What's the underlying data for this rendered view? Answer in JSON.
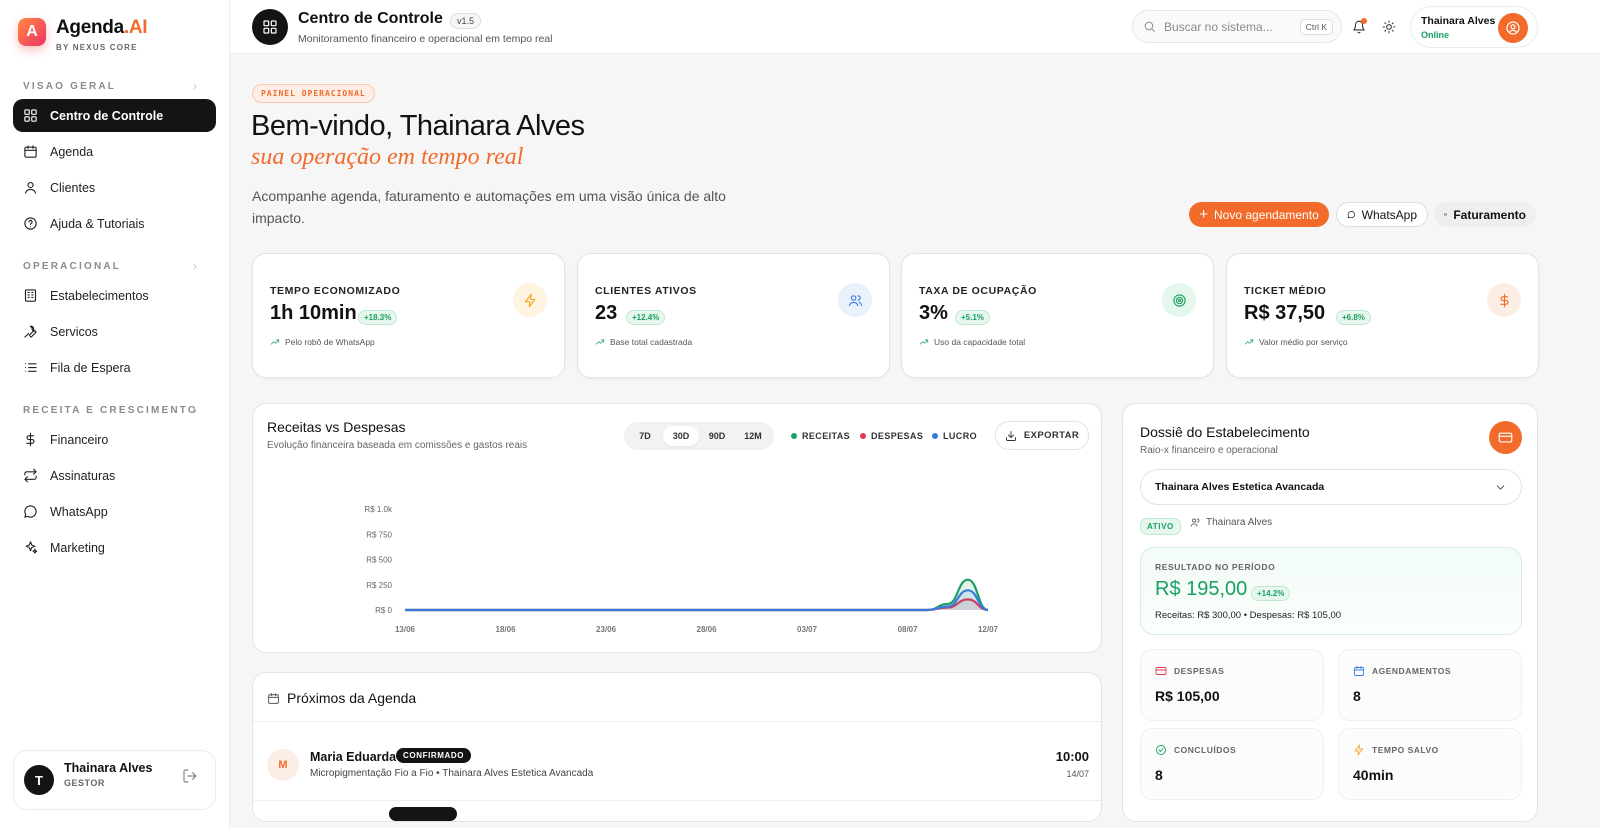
{
  "brand": {
    "logo_letter": "A",
    "name_main": "Agenda",
    "name_accent": ".AI",
    "subtitle": "BY NEXUS CORE"
  },
  "sidebar": {
    "sections": [
      {
        "title": "VISAO GERAL",
        "items": [
          {
            "label": "Centro de Controle",
            "icon": "grid-icon",
            "active": true
          },
          {
            "label": "Agenda",
            "icon": "calendar-icon"
          },
          {
            "label": "Clientes",
            "icon": "user-icon"
          },
          {
            "label": "Ajuda & Tutoriais",
            "icon": "help-icon"
          }
        ]
      },
      {
        "title": "OPERACIONAL",
        "items": [
          {
            "label": "Estabelecimentos",
            "icon": "building-icon"
          },
          {
            "label": "Servicos",
            "icon": "wrench-icon"
          },
          {
            "label": "Fila de Espera",
            "icon": "list-icon"
          }
        ]
      },
      {
        "title": "RECEITA E CRESCIMENTO",
        "items": [
          {
            "label": "Financeiro",
            "icon": "dollar-icon"
          },
          {
            "label": "Assinaturas",
            "icon": "repeat-icon"
          },
          {
            "label": "WhatsApp",
            "icon": "chat-icon"
          },
          {
            "label": "Marketing",
            "icon": "sparkle-icon"
          }
        ]
      }
    ],
    "user": {
      "initial": "T",
      "name": "Thainara Alves",
      "role": "GESTOR"
    }
  },
  "header": {
    "title": "Centro de Controle",
    "version": "v1.5",
    "subtitle": "Monitoramento financeiro e operacional em tempo real",
    "search_placeholder": "Buscar no sistema...",
    "shortcut": "Ctrl K",
    "user_name": "Thainara Alves",
    "user_status": "Online"
  },
  "hero": {
    "badge": "PAINEL OPERACIONAL",
    "welcome": "Bem-vindo, Thainara Alves",
    "tagline": "sua operação em tempo real",
    "description": "Acompanhe agenda, faturamento e automações em uma visão única de alto impacto.",
    "buttons": {
      "new": "Novo agendamento",
      "whatsapp": "WhatsApp",
      "billing": "Faturamento"
    }
  },
  "kpis": [
    {
      "label": "TEMPO ECONOMIZADO",
      "value": "1h 10min",
      "delta": "+18.3%",
      "note": "Pelo robô de WhatsApp",
      "icon": "bolt-icon",
      "color": "#f5a623",
      "bg": "#fff4e0"
    },
    {
      "label": "CLIENTES ATIVOS",
      "value": "23",
      "delta": "+12.4%",
      "note": "Base total cadastrada",
      "icon": "users-icon",
      "color": "#3b7be0",
      "bg": "#e9f1fd"
    },
    {
      "label": "TAXA DE OCUPAÇÃO",
      "value": "3%",
      "delta": "+5.1%",
      "note": "Uso da capacidade total",
      "icon": "target-icon",
      "color": "#1aa061",
      "bg": "#e4f7ec"
    },
    {
      "label": "TICKET MÉDIO",
      "value": "R$ 37,50",
      "delta": "+6.8%",
      "note": "Valor médio por serviço",
      "icon": "dollar-icon",
      "color": "#f26b2a",
      "bg": "#fdeee5"
    }
  ],
  "chart_card": {
    "title": "Receitas vs Despesas",
    "subtitle": "Evolução financeira baseada em comissões e gastos reais",
    "periods": [
      "7D",
      "30D",
      "90D",
      "12M"
    ],
    "active_period": "30D",
    "export": "EXPORTAR"
  },
  "chart_data": {
    "type": "area",
    "title": "Receitas vs Despesas",
    "x": [
      "13/06",
      "14/06",
      "15/06",
      "16/06",
      "17/06",
      "18/06",
      "19/06",
      "20/06",
      "21/06",
      "22/06",
      "23/06",
      "24/06",
      "25/06",
      "26/06",
      "27/06",
      "28/06",
      "29/06",
      "30/06",
      "01/07",
      "02/07",
      "03/07",
      "04/07",
      "05/07",
      "06/07",
      "07/07",
      "08/07",
      "09/07",
      "10/07",
      "11/07",
      "12/07"
    ],
    "xticks": [
      "13/06",
      "18/06",
      "23/06",
      "28/06",
      "03/07",
      "08/07",
      "12/07"
    ],
    "yticks": [
      "R$ 0",
      "R$ 250",
      "R$ 500",
      "R$ 750",
      "R$ 1.0k"
    ],
    "ylim": [
      0,
      1000
    ],
    "series": [
      {
        "name": "RECEITAS",
        "color": "#1aa061",
        "values": [
          0,
          0,
          0,
          0,
          0,
          0,
          0,
          0,
          0,
          0,
          0,
          0,
          0,
          0,
          0,
          0,
          0,
          0,
          0,
          0,
          0,
          0,
          0,
          0,
          0,
          0,
          0,
          60,
          300,
          0
        ]
      },
      {
        "name": "DESPESAS",
        "color": "#e0384e",
        "values": [
          0,
          0,
          0,
          0,
          0,
          0,
          0,
          0,
          0,
          0,
          0,
          0,
          0,
          0,
          0,
          0,
          0,
          0,
          0,
          0,
          0,
          0,
          0,
          0,
          0,
          0,
          0,
          25,
          105,
          0
        ]
      },
      {
        "name": "LUCRO",
        "color": "#3b7be0",
        "values": [
          0,
          0,
          0,
          0,
          0,
          0,
          0,
          0,
          0,
          0,
          0,
          0,
          0,
          0,
          0,
          0,
          0,
          0,
          0,
          0,
          0,
          0,
          0,
          0,
          0,
          0,
          0,
          35,
          195,
          0
        ]
      }
    ]
  },
  "agenda": {
    "title": "Próximos da Agenda",
    "items": [
      {
        "initial": "M",
        "name": "Maria Eduarda",
        "status": "CONFIRMADO",
        "desc": "Micropigmentação Fio a Fio • Thainara Alves Estetica Avancada",
        "time": "10:00",
        "date": "14/07"
      }
    ]
  },
  "dossier": {
    "title": "Dossiê do Estabelecimento",
    "subtitle": "Raio-x financeiro e operacional",
    "selected": "Thainara Alves Estetica Avancada",
    "status": "ATIVO",
    "owner": "Thainara Alves",
    "result_label": "RESULTADO NO PERÍODO",
    "result_value": "R$ 195,00",
    "result_delta": "+14.2%",
    "result_detail": "Receitas: R$ 300,00 • Despesas: R$ 105,00",
    "stats": [
      {
        "label": "DESPESAS",
        "value": "R$ 105,00",
        "icon": "card-icon",
        "color": "#e0384e"
      },
      {
        "label": "AGENDAMENTOS",
        "value": "8",
        "icon": "calendar-icon",
        "color": "#3b7be0"
      },
      {
        "label": "CONCLUÍDOS",
        "value": "8",
        "icon": "check-icon",
        "color": "#1aa061"
      },
      {
        "label": "TEMPO SALVO",
        "value": "40min",
        "icon": "bolt-icon",
        "color": "#f5a623"
      }
    ]
  }
}
